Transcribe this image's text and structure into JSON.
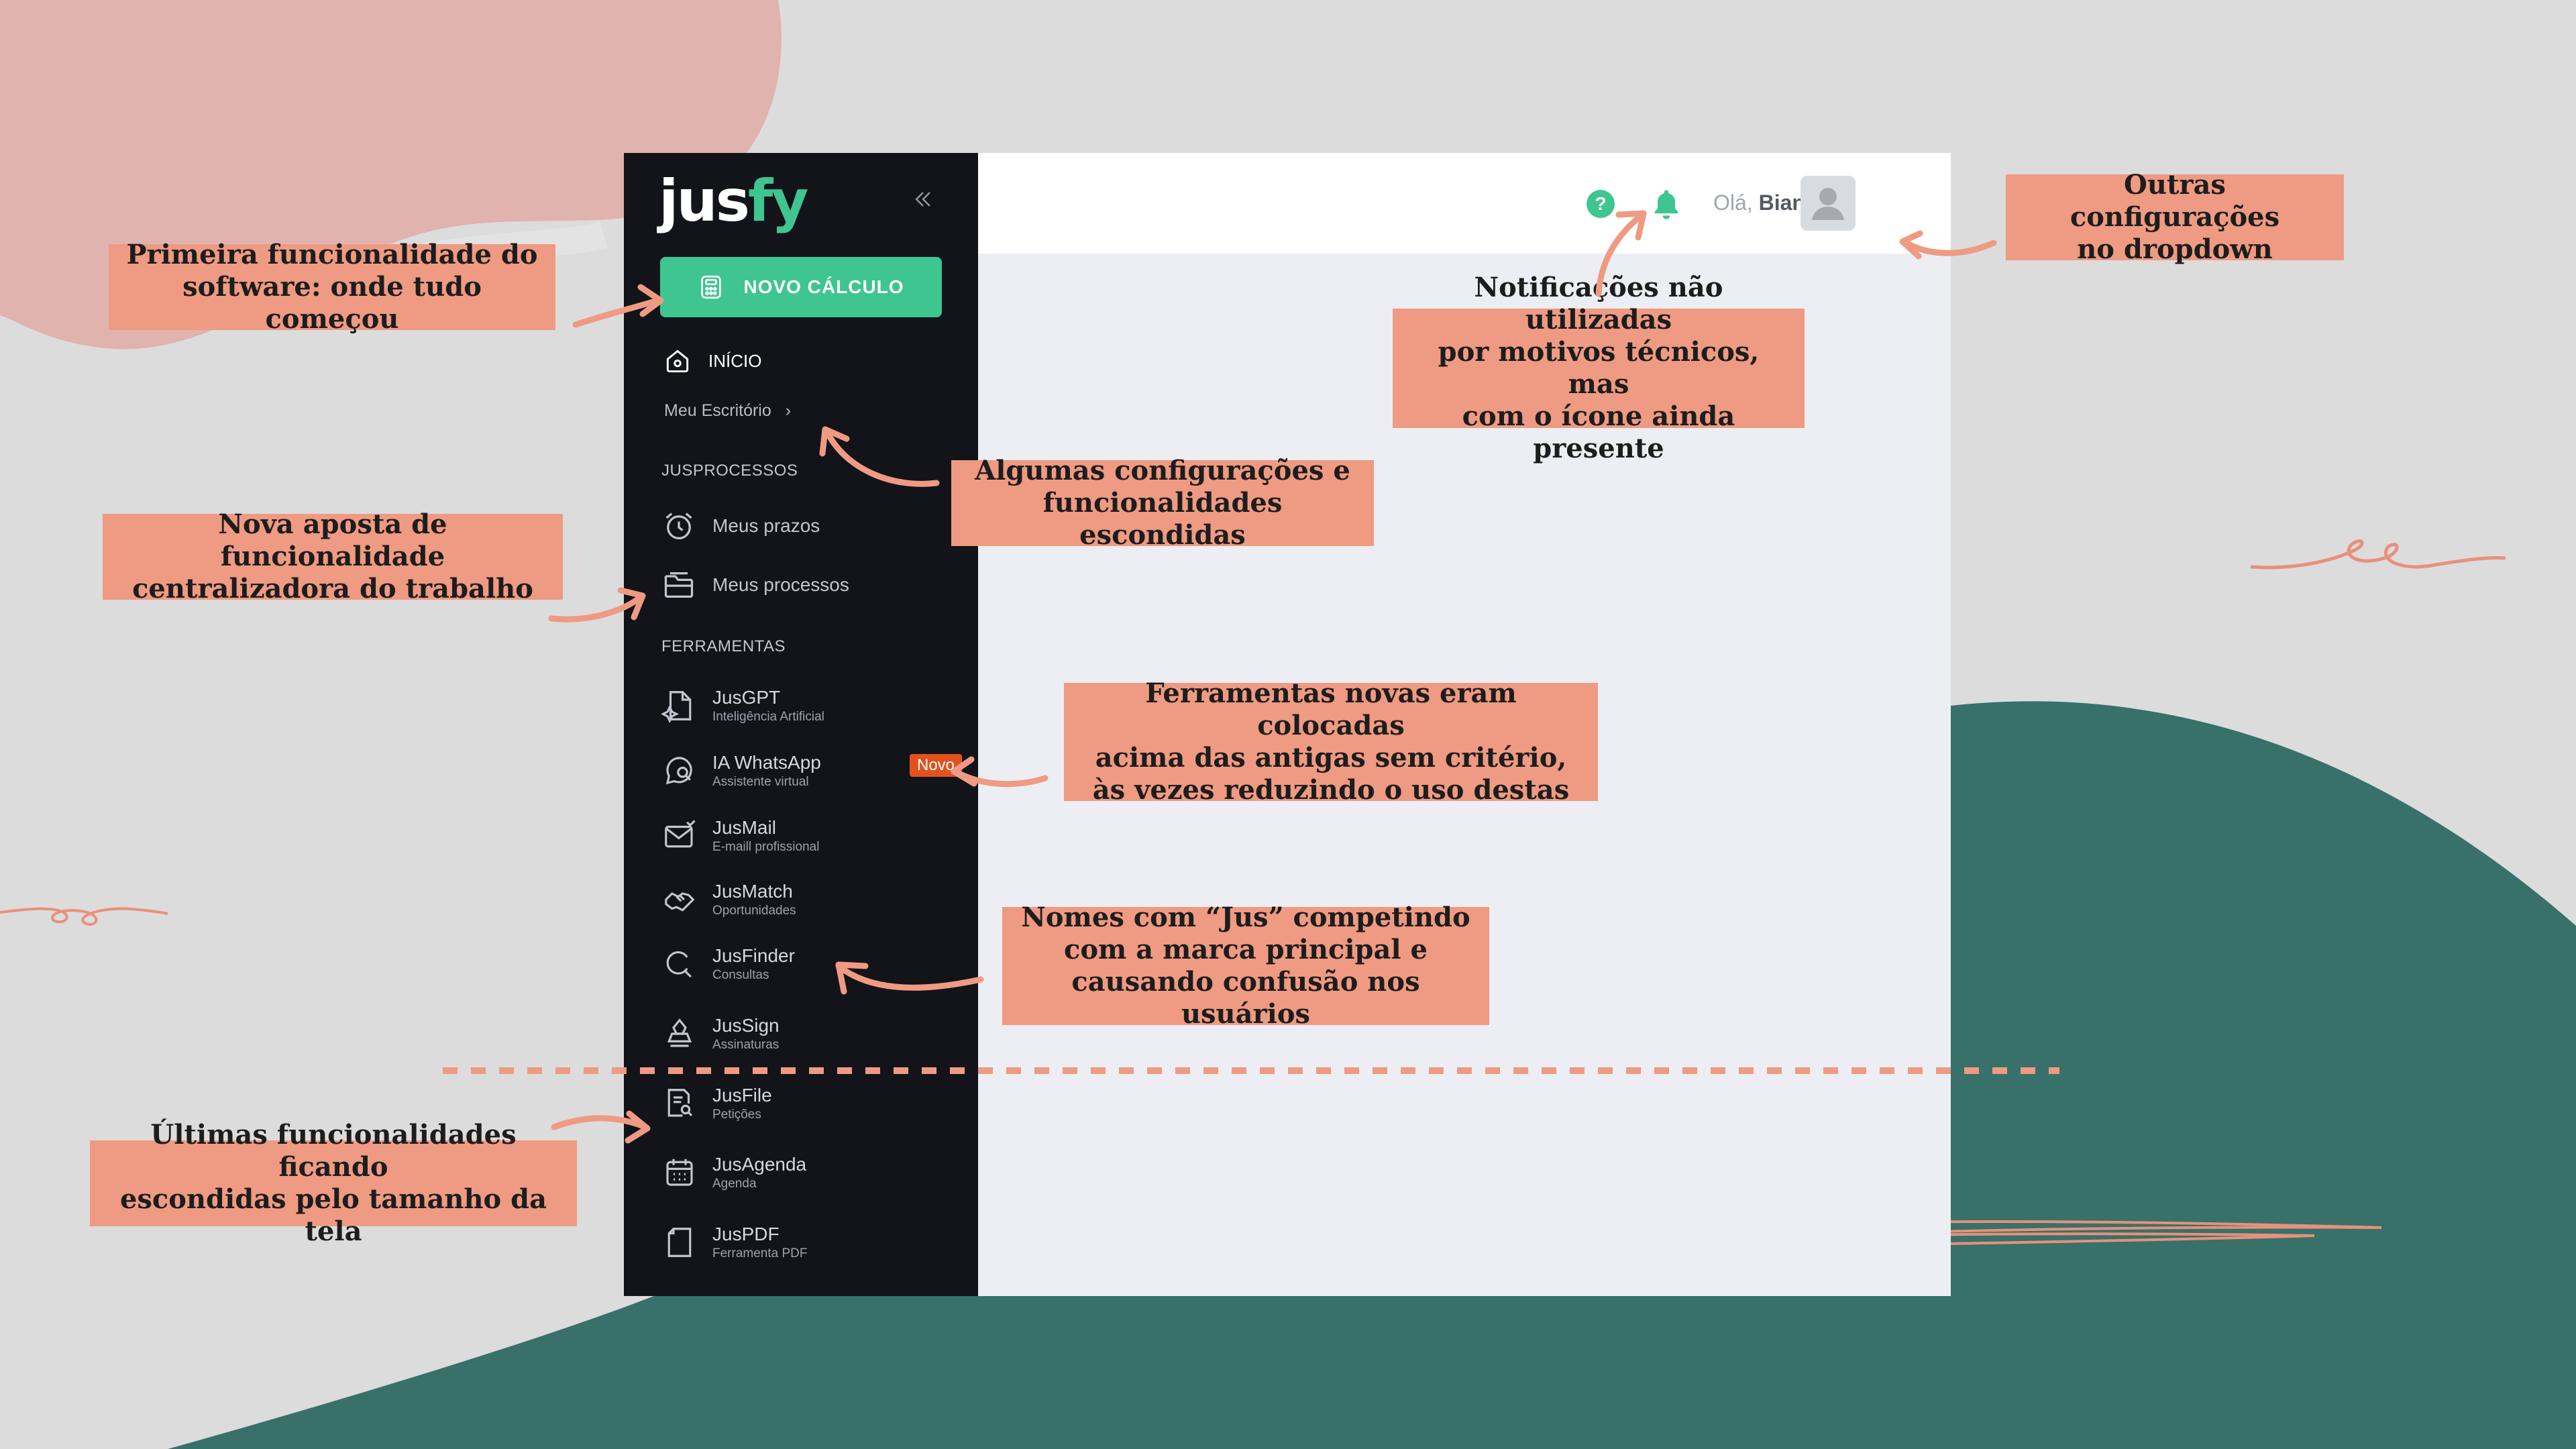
{
  "colors": {
    "background": "#dcdcdc",
    "coral_blob": "#e1b3ae",
    "teal_blob": "#37716a",
    "sidebar": "#12141a",
    "accent_green": "#3fc590",
    "badge_orange": "#e2521d",
    "callout": "#ef9a82",
    "annotation_stroke": "#e8907c"
  },
  "app": {
    "logo": {
      "text_main": "jus",
      "text_accent": "fy"
    },
    "collapse_icon": "double-chevron-left-icon",
    "new_calc_button": {
      "label": "NOVO CÁLCULO",
      "icon": "calculator-icon"
    },
    "home": {
      "label": "INÍCIO",
      "icon": "home-icon"
    },
    "office_link": {
      "label": "Meu Escritório",
      "arrow": "›"
    },
    "sections": {
      "jusprocessos": "JUSPROCESSOS",
      "ferramentas": "FERRAMENTAS"
    },
    "jusprocessos_items": [
      {
        "label": "Meus prazos",
        "icon": "alarm-clock-icon"
      },
      {
        "label": "Meus processos",
        "icon": "folder-icon"
      }
    ],
    "tools": [
      {
        "name": "JusGPT",
        "sub": "Inteligência Artificial",
        "icon": "sparkle-doc-icon"
      },
      {
        "name": "IA WhatsApp",
        "sub": "Assistente virtual",
        "icon": "chat-search-icon",
        "badge": "Novo"
      },
      {
        "name": "JusMail",
        "sub": "E-maill profissional",
        "icon": "mail-icon"
      },
      {
        "name": "JusMatch",
        "sub": "Oportunidades",
        "icon": "handshake-icon"
      },
      {
        "name": "JusFinder",
        "sub": "Consultas",
        "icon": "search-icon"
      },
      {
        "name": "JusSign",
        "sub": "Assinaturas",
        "icon": "stamp-icon"
      },
      {
        "name": "JusFile",
        "sub": "Petições",
        "icon": "file-search-icon"
      },
      {
        "name": "JusAgenda",
        "sub": "Agenda",
        "icon": "calendar-icon"
      },
      {
        "name": "JusPDF",
        "sub": "Ferramenta PDF",
        "icon": "pdf-file-icon"
      }
    ],
    "topbar": {
      "help_icon": "?",
      "bell_icon": "bell-icon",
      "greeting_prefix": "Olá, ",
      "user_name": "Bianca",
      "avatar_icon": "user-avatar-icon"
    }
  },
  "annotations": {
    "first_feature": [
      "Primeira funcionalidade do",
      "software: onde tudo começou"
    ],
    "centralizer": [
      "Nova aposta de funcionalidade",
      "centralizadora do trabalho"
    ],
    "hidden_settings": [
      "Algumas configurações e",
      "funcionalidades escondidas"
    ],
    "notifications": [
      "Notificações não utilizadas",
      "por motivos técnicos, mas",
      "com o ícone ainda presente"
    ],
    "dropdown": [
      "Outras configurações",
      "no dropdown"
    ],
    "new_tools": [
      "Ferramentas novas eram colocadas",
      "acima das antigas sem critério,",
      "às vezes reduzindo o uso destas"
    ],
    "jus_names": [
      "Nomes com “Jus” competindo",
      "com a marca principal e",
      "causando confusão nos usuários"
    ],
    "last_features": [
      "Últimas funcionalidades ficando",
      "escondidas pelo tamanho da tela"
    ]
  }
}
